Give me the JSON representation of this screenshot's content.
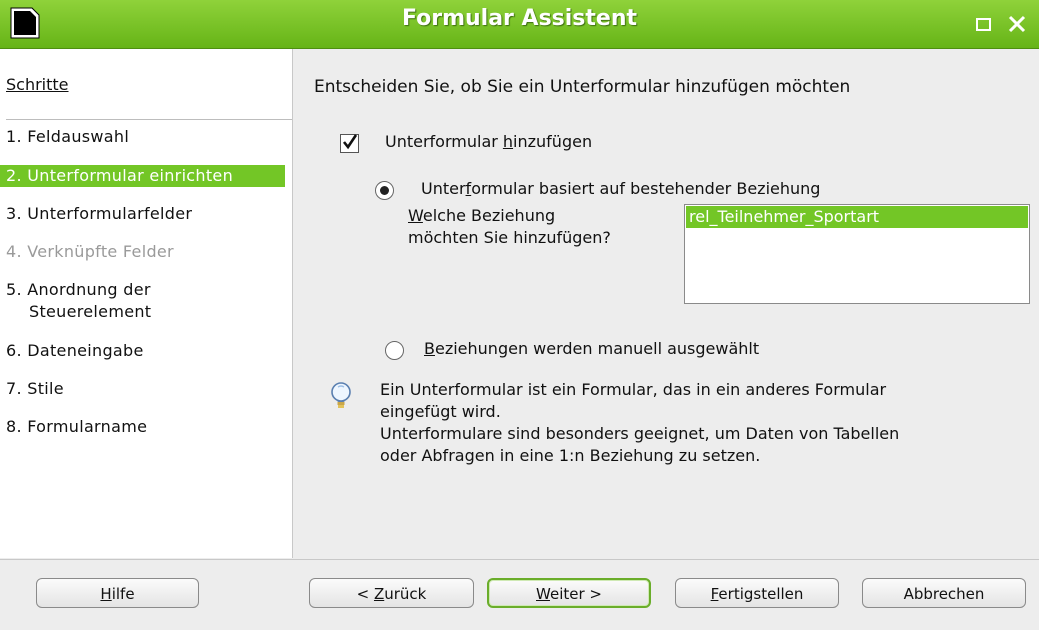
{
  "window": {
    "title": "Formular Assistent"
  },
  "sidebar": {
    "title": "Schritte",
    "steps": [
      {
        "label": "1. Feldauswahl",
        "state": "normal"
      },
      {
        "label": "2. Unterformular einrichten",
        "state": "active"
      },
      {
        "label": "3. Unterformularfelder",
        "state": "normal"
      },
      {
        "label": "4. Verknüpfte Felder",
        "state": "disabled"
      },
      {
        "label": "5. Anordnung der",
        "label2": "Steuerelement",
        "state": "normal"
      },
      {
        "label": "6. Dateneingabe",
        "state": "normal"
      },
      {
        "label": "7. Stile",
        "state": "normal"
      },
      {
        "label": "8. Formularname",
        "state": "normal"
      }
    ]
  },
  "main": {
    "headline": "Entscheiden Sie, ob Sie ein Unterformular hinzufügen möchten",
    "add_subform": {
      "pre": "Unterformular ",
      "accel": "h",
      "post": "inzufügen",
      "checked": true
    },
    "option_existing": {
      "pre": "Unter",
      "accel": "f",
      "post": "ormular basiert auf bestehender Beziehung",
      "selected": true
    },
    "question": {
      "accel": "W",
      "line1_rest": "elche Beziehung",
      "line2": "möchten Sie hinzufügen?"
    },
    "relations": [
      "rel_Teilnehmer_Sportart"
    ],
    "option_manual": {
      "accel": "B",
      "post": "eziehungen werden manuell ausgewählt",
      "selected": false
    },
    "info_lines": [
      "Ein Unterformular ist ein Formular, das in ein anderes Formular",
      "eingefügt wird.",
      "Unterformulare sind besonders geeignet, um Daten von Tabellen",
      "oder Abfragen in eine 1:n Beziehung zu setzen."
    ]
  },
  "buttons": {
    "help": {
      "accel": "H",
      "post": "ilfe"
    },
    "back": {
      "pre": "< ",
      "accel": "Z",
      "post": "urück"
    },
    "next": {
      "accel": "W",
      "post": "eiter >"
    },
    "finish": {
      "accel": "F",
      "post": "ertigstellen"
    },
    "cancel": {
      "label": "Abbrechen"
    }
  },
  "colors": {
    "accent": "#73c626",
    "titlebar": "#66b417"
  }
}
